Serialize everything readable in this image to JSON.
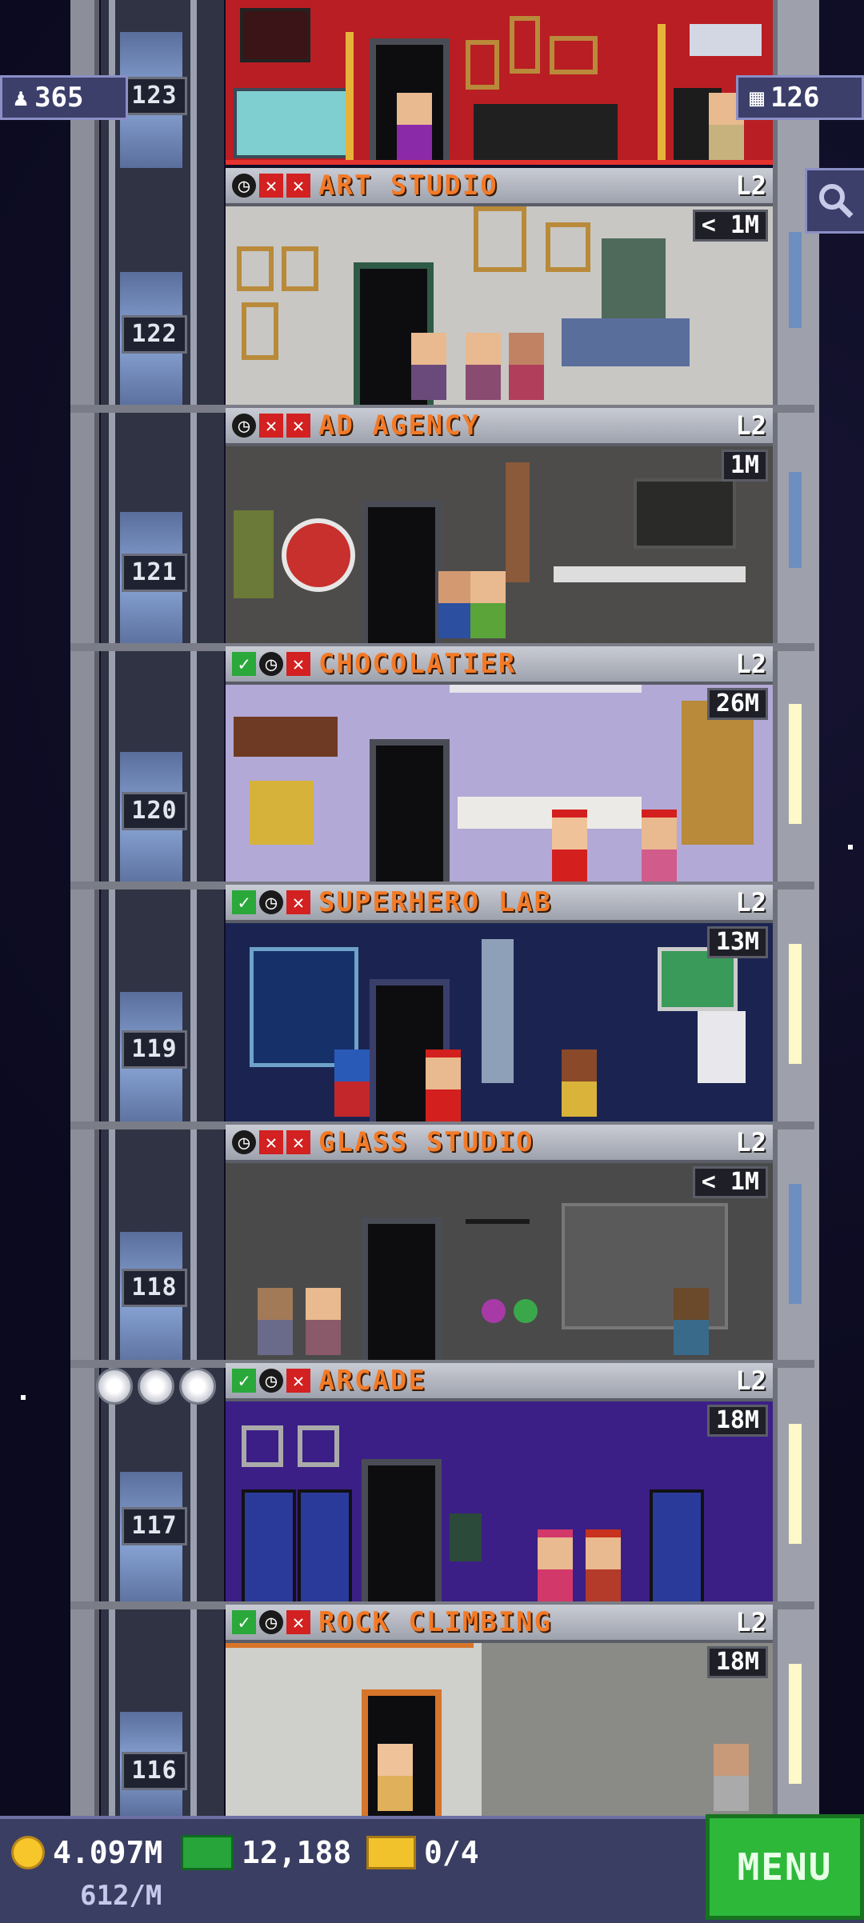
{
  "hud": {
    "residents": "365",
    "floors": "126"
  },
  "shaft_labels": [
    "123",
    "122",
    "121",
    "120",
    "119",
    "118",
    "117",
    "116"
  ],
  "floors": [
    {
      "name": "ART STUDIO",
      "level": "L2",
      "value": "< 1M",
      "status": [
        "clock",
        "x",
        "x"
      ]
    },
    {
      "name": "AD AGENCY",
      "level": "L2",
      "value": "1M",
      "status": [
        "clock",
        "x",
        "x"
      ]
    },
    {
      "name": "CHOCOLATIER",
      "level": "L2",
      "value": "26M",
      "status": [
        "check",
        "clock",
        "x"
      ]
    },
    {
      "name": "SUPERHERO LAB",
      "level": "L2",
      "value": "13M",
      "status": [
        "check",
        "clock",
        "x"
      ]
    },
    {
      "name": "GLASS STUDIO",
      "level": "L2",
      "value": "< 1M",
      "status": [
        "clock",
        "x",
        "x"
      ]
    },
    {
      "name": "ARCADE",
      "level": "L2",
      "value": "18M",
      "status": [
        "check",
        "clock",
        "x"
      ]
    },
    {
      "name": "ROCK CLIMBING",
      "level": "L2",
      "value": "18M",
      "status": [
        "check",
        "clock",
        "x"
      ]
    }
  ],
  "bottom": {
    "coins": "4.097M",
    "bux": "12,188",
    "tickets": "0/4",
    "rate": "612/M",
    "menu_label": "MENU"
  },
  "icons": {
    "residents": "person-icon",
    "floors": "building-icon",
    "search": "magnifier-icon",
    "coin": "coin-icon",
    "bux": "tower-bux-icon",
    "ticket": "ticket-icon"
  },
  "colors": {
    "floor_name": "#f37a27",
    "menu": "#2eb83a",
    "hud": "#3b3f6a"
  }
}
